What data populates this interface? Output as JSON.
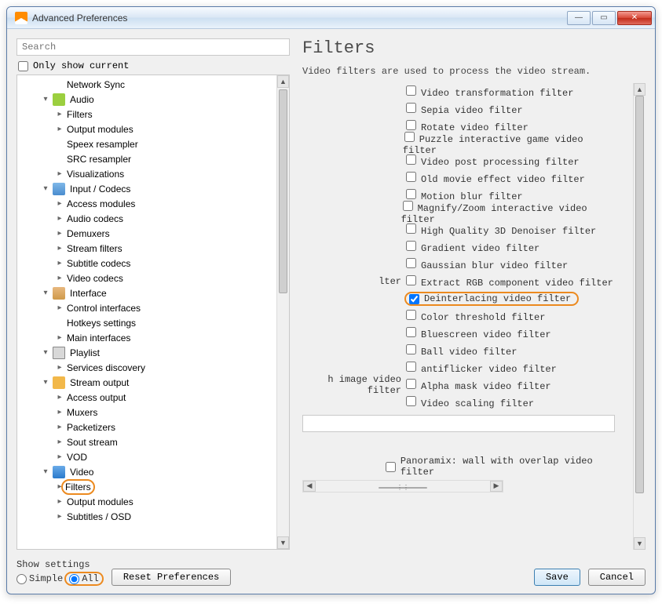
{
  "window": {
    "title": "Advanced Preferences"
  },
  "search": {
    "placeholder": "Search"
  },
  "only_current": "Only show current",
  "tree": [
    {
      "depth": 2,
      "expander": "",
      "icon": "",
      "label": "Network Sync",
      "name": "tree-network-sync"
    },
    {
      "depth": 1,
      "expander": "▾",
      "icon": "audio",
      "label": "Audio",
      "name": "tree-audio"
    },
    {
      "depth": 2,
      "expander": "▸",
      "icon": "",
      "label": "Filters",
      "name": "tree-audio-filters"
    },
    {
      "depth": 2,
      "expander": "▸",
      "icon": "",
      "label": "Output modules",
      "name": "tree-audio-output"
    },
    {
      "depth": 2,
      "expander": "",
      "icon": "",
      "label": "Speex resampler",
      "name": "tree-speex"
    },
    {
      "depth": 2,
      "expander": "",
      "icon": "",
      "label": "SRC resampler",
      "name": "tree-src"
    },
    {
      "depth": 2,
      "expander": "▸",
      "icon": "",
      "label": "Visualizations",
      "name": "tree-visualizations"
    },
    {
      "depth": 1,
      "expander": "▾",
      "icon": "input",
      "label": "Input / Codecs",
      "name": "tree-input-codecs"
    },
    {
      "depth": 2,
      "expander": "▸",
      "icon": "",
      "label": "Access modules",
      "name": "tree-access-modules"
    },
    {
      "depth": 2,
      "expander": "▸",
      "icon": "",
      "label": "Audio codecs",
      "name": "tree-audio-codecs"
    },
    {
      "depth": 2,
      "expander": "▸",
      "icon": "",
      "label": "Demuxers",
      "name": "tree-demuxers"
    },
    {
      "depth": 2,
      "expander": "▸",
      "icon": "",
      "label": "Stream filters",
      "name": "tree-stream-filters"
    },
    {
      "depth": 2,
      "expander": "▸",
      "icon": "",
      "label": "Subtitle codecs",
      "name": "tree-subtitle-codecs"
    },
    {
      "depth": 2,
      "expander": "▸",
      "icon": "",
      "label": "Video codecs",
      "name": "tree-video-codecs"
    },
    {
      "depth": 1,
      "expander": "▾",
      "icon": "interface",
      "label": "Interface",
      "name": "tree-interface"
    },
    {
      "depth": 2,
      "expander": "▸",
      "icon": "",
      "label": "Control interfaces",
      "name": "tree-control-interfaces"
    },
    {
      "depth": 2,
      "expander": "",
      "icon": "",
      "label": "Hotkeys settings",
      "name": "tree-hotkeys"
    },
    {
      "depth": 2,
      "expander": "▸",
      "icon": "",
      "label": "Main interfaces",
      "name": "tree-main-interfaces"
    },
    {
      "depth": 1,
      "expander": "▾",
      "icon": "playlist",
      "label": "Playlist",
      "name": "tree-playlist"
    },
    {
      "depth": 2,
      "expander": "▸",
      "icon": "",
      "label": "Services discovery",
      "name": "tree-services-discovery"
    },
    {
      "depth": 1,
      "expander": "▾",
      "icon": "stream",
      "label": "Stream output",
      "name": "tree-stream-output"
    },
    {
      "depth": 2,
      "expander": "▸",
      "icon": "",
      "label": "Access output",
      "name": "tree-access-output"
    },
    {
      "depth": 2,
      "expander": "▸",
      "icon": "",
      "label": "Muxers",
      "name": "tree-muxers"
    },
    {
      "depth": 2,
      "expander": "▸",
      "icon": "",
      "label": "Packetizers",
      "name": "tree-packetizers"
    },
    {
      "depth": 2,
      "expander": "▸",
      "icon": "",
      "label": "Sout stream",
      "name": "tree-sout-stream"
    },
    {
      "depth": 2,
      "expander": "▸",
      "icon": "",
      "label": "VOD",
      "name": "tree-vod"
    },
    {
      "depth": 1,
      "expander": "▾",
      "icon": "video",
      "label": "Video",
      "name": "tree-video"
    },
    {
      "depth": 2,
      "expander": "▸",
      "icon": "",
      "label": "Filters",
      "name": "tree-video-filters",
      "highlighted": true
    },
    {
      "depth": 2,
      "expander": "▸",
      "icon": "",
      "label": "Output modules",
      "name": "tree-video-output"
    },
    {
      "depth": 2,
      "expander": "▸",
      "icon": "",
      "label": "Subtitles / OSD",
      "name": "tree-subtitles-osd"
    }
  ],
  "right": {
    "title": "Filters",
    "desc": "Video filters are used to process the video stream.",
    "filters": [
      {
        "left": "",
        "label": "Video transformation filter",
        "checked": false
      },
      {
        "left": "",
        "label": "Sepia video filter",
        "checked": false
      },
      {
        "left": "",
        "label": "Rotate video filter",
        "checked": false
      },
      {
        "left": "",
        "label": "Puzzle interactive game video filter",
        "checked": false
      },
      {
        "left": "",
        "label": "Video post processing filter",
        "checked": false
      },
      {
        "left": "",
        "label": "Old movie effect video filter",
        "checked": false
      },
      {
        "left": "",
        "label": "Motion blur filter",
        "checked": false
      },
      {
        "left": "",
        "label": "Magnify/Zoom interactive video filter",
        "checked": false
      },
      {
        "left": "",
        "label": "High Quality 3D Denoiser filter",
        "checked": false
      },
      {
        "left": "",
        "label": "Gradient video filter",
        "checked": false
      },
      {
        "left": "",
        "label": "Gaussian blur video filter",
        "checked": false
      },
      {
        "left": "lter",
        "label": "Extract RGB component video filter",
        "checked": false
      },
      {
        "left": "",
        "label": "Deinterlacing video filter",
        "checked": true,
        "highlighted": true
      },
      {
        "left": "",
        "label": "Color threshold filter",
        "checked": false
      },
      {
        "left": "",
        "label": "Bluescreen video filter",
        "checked": false
      },
      {
        "left": "",
        "label": "Ball video filter",
        "checked": false
      },
      {
        "left": "",
        "label": "antiflicker video filter",
        "checked": false
      },
      {
        "left": "h image video filter",
        "label": "Alpha mask video filter",
        "checked": false
      },
      {
        "left": "",
        "label": "Video scaling filter",
        "checked": false
      }
    ],
    "panoramix": "Panoramix: wall with overlap video filter"
  },
  "footer": {
    "show_settings": "Show settings",
    "simple": "Simple",
    "all": "All",
    "reset": "Reset Preferences",
    "save": "Save",
    "cancel": "Cancel"
  }
}
